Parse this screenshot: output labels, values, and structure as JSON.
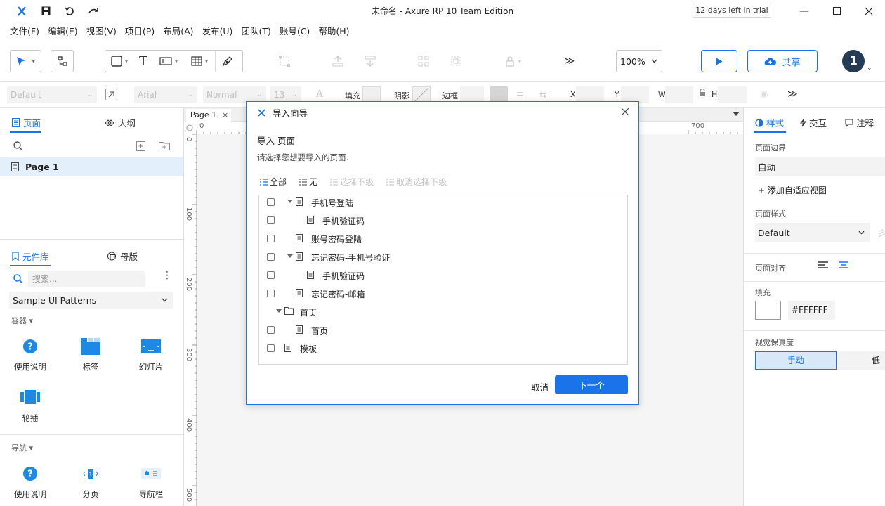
{
  "window": {
    "title": "未命名 - Axure RP 10 Team Edition",
    "trial_badge": "12 days left in trial",
    "app_icon": "axure-x-icon"
  },
  "menu": [
    "文件(F)",
    "编辑(E)",
    "视图(V)",
    "项目(P)",
    "布局(A)",
    "发布(U)",
    "团队(T)",
    "账号(C)",
    "帮助(H)"
  ],
  "toolbar": {
    "zoom": "100%",
    "share_label": "共享",
    "more": "≫",
    "user_initial": "1"
  },
  "stylebar": {
    "style_value": "Default",
    "font_value": "Arial",
    "weight_value": "Normal",
    "size_value": "13",
    "fill_label": "填充",
    "shadow_label": "阴影",
    "border_label": "边框",
    "x_label": "X",
    "y_label": "Y",
    "w_label": "W",
    "h_label": "H"
  },
  "left": {
    "pages_tab": "页面",
    "outline_tab": "大纲",
    "page_item": "Page 1",
    "library_tab": "元件库",
    "masters_tab": "母版",
    "search_placeholder": "搜索...",
    "library_select": "Sample UI Patterns",
    "section_containers": "容器",
    "section_nav": "导航",
    "widgets_containers": [
      "使用说明",
      "标签",
      "幻灯片",
      "轮播"
    ],
    "widgets_nav": [
      "使用说明",
      "分页",
      "导航栏"
    ]
  },
  "canvas": {
    "tab_label": "Page 1",
    "ruler_h": [
      "0",
      "700"
    ],
    "ruler_v": [
      "0",
      "100",
      "200",
      "300",
      "400",
      "500"
    ]
  },
  "right": {
    "tab_style": "样式",
    "tab_interact": "交互",
    "tab_notes": "注释",
    "page_dimensions_label": "页面边界",
    "page_dimensions_value": "自动",
    "add_adaptive": "+ 添加自适应视图",
    "page_style_label": "页面样式",
    "page_style_value": "Default",
    "page_align_label": "页面对齐",
    "fill_label": "填充",
    "fill_color": "#FFFFFF",
    "fidelity_label": "视觉保真度",
    "fidelity_manual": "手动",
    "fidelity_low": "低"
  },
  "dialog": {
    "title": "导入向导",
    "heading": "导入 页面",
    "subheading": "请选择您想要导入的页面.",
    "select_all": "全部",
    "select_none": "无",
    "select_children": "选择下级",
    "deselect_children": "取消选择下级",
    "tree": [
      {
        "label": "手机号登陆",
        "type": "page",
        "indent": 1,
        "checkbox": true,
        "expanded": true
      },
      {
        "label": "手机验证码",
        "type": "page",
        "indent": 2,
        "checkbox": true,
        "expanded": null
      },
      {
        "label": "账号密码登陆",
        "type": "page",
        "indent": 1,
        "checkbox": true,
        "expanded": null
      },
      {
        "label": "忘记密码-手机号验证",
        "type": "page",
        "indent": 1,
        "checkbox": true,
        "expanded": true
      },
      {
        "label": "手机验证码",
        "type": "page",
        "indent": 2,
        "checkbox": true,
        "expanded": null
      },
      {
        "label": "忘记密码-邮箱",
        "type": "page",
        "indent": 1,
        "checkbox": true,
        "expanded": null
      },
      {
        "label": "首页",
        "type": "folder",
        "indent": 0,
        "checkbox": false,
        "expanded": true
      },
      {
        "label": "首页",
        "type": "page",
        "indent": 1,
        "checkbox": true,
        "expanded": null
      },
      {
        "label": "模板",
        "type": "page",
        "indent": 0,
        "checkbox": true,
        "expanded": null
      }
    ],
    "cancel_label": "取消",
    "next_label": "下一个"
  },
  "colors": {
    "accent": "#1a73e8",
    "selection_bg": "#e3effa"
  }
}
